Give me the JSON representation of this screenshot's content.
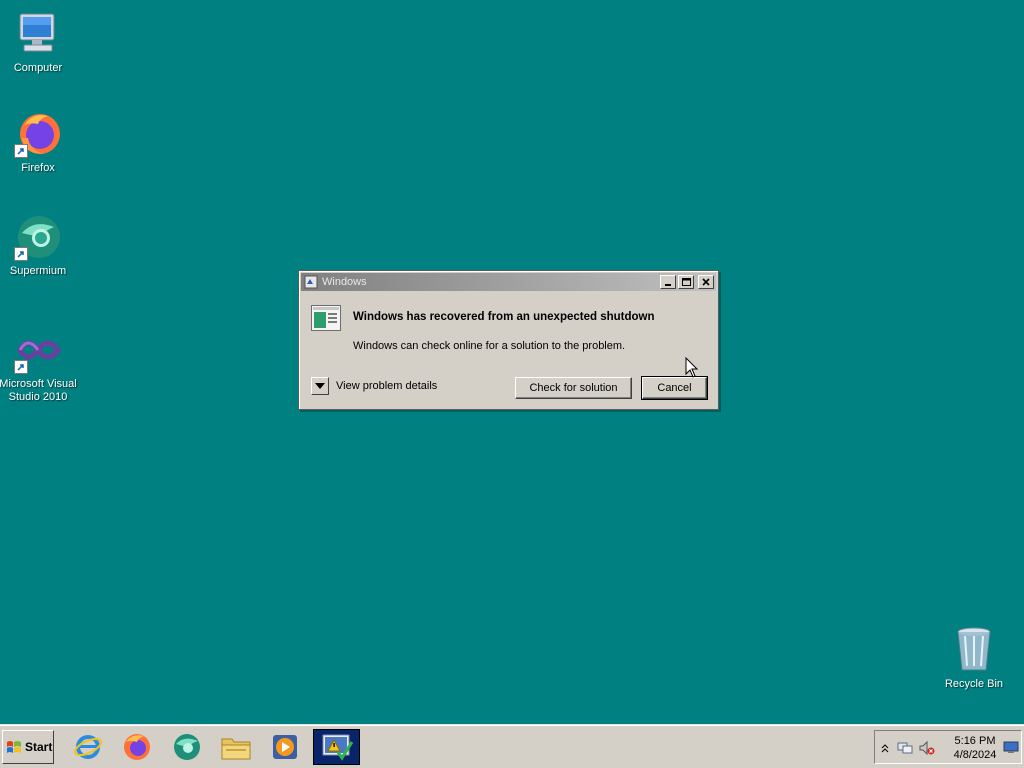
{
  "desktop": {
    "background_color": "#008080",
    "icons": [
      {
        "label": "Computer",
        "icon": "computer-icon"
      },
      {
        "label": "Firefox",
        "icon": "firefox-icon"
      },
      {
        "label": "Supermium",
        "icon": "supermium-icon"
      },
      {
        "label": "Microsoft Visual Studio 2010",
        "icon": "visual-studio-icon"
      },
      {
        "label": "Recycle Bin",
        "icon": "recycle-bin-icon"
      }
    ]
  },
  "dialog": {
    "title": "Windows",
    "heading": "Windows has recovered from an unexpected shutdown",
    "message": "Windows can check online for a solution to the problem.",
    "details_label": "View problem details",
    "check_button": "Check for solution",
    "cancel_button": "Cancel"
  },
  "taskbar": {
    "start_label": "Start",
    "pinned": [
      {
        "icon": "internet-explorer-icon"
      },
      {
        "icon": "firefox-icon"
      },
      {
        "icon": "supermium-icon"
      },
      {
        "icon": "file-explorer-icon"
      },
      {
        "icon": "media-player-icon"
      },
      {
        "icon": "action-center-icon",
        "active": true
      }
    ],
    "tray": {
      "time": "5:16 PM",
      "date": "4/8/2024",
      "icons": [
        "show-hidden-icons-icon",
        "network-icon",
        "volume-muted-icon",
        "show-desktop-icon"
      ]
    }
  },
  "colors": {
    "desktop": "#008080",
    "window_chrome": "#d4d0c8",
    "active_task": "#0a246a"
  }
}
